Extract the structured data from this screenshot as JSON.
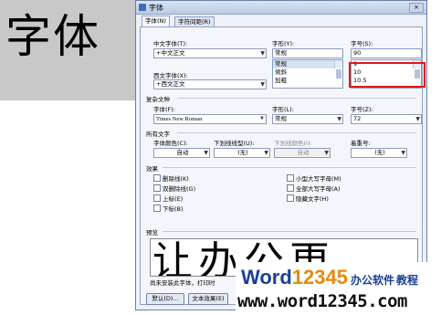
{
  "background_sample": {
    "text": "字体"
  },
  "window": {
    "title": "字体",
    "close_label": "×"
  },
  "tabs": [
    {
      "label": "字体(N)",
      "active": true
    },
    {
      "label": "字符间距(R)",
      "active": false
    }
  ],
  "chinese_font": {
    "label": "中文字体(T):",
    "value": "+中文正文"
  },
  "western_font": {
    "label": "西文字体(X):",
    "value": "+西文正文"
  },
  "style": {
    "label": "字形(Y):",
    "value": "常规",
    "options": [
      "常规",
      "倾斜",
      "加粗"
    ],
    "selected": "常规"
  },
  "size": {
    "label": "字号(S):",
    "value": "90",
    "options": [
      "9",
      "10",
      "10.5"
    ]
  },
  "complex_script": {
    "section_label": "复杂文种",
    "font_label": "字体(F):",
    "font_value": "Times New Roman",
    "style_label": "字形(L):",
    "style_value": "常规",
    "size_label": "字号(Z):",
    "size_value": "72"
  },
  "all_text": {
    "section_label": "所有文字",
    "color_label": "字体颜色(C):",
    "color_value": "自动",
    "underline_label": "下划线线型(U):",
    "underline_value": "(无)",
    "underline_color_label": "下划线颜色(I):",
    "underline_color_value": "自动",
    "emphasis_label": "着重号:",
    "emphasis_value": "(无)"
  },
  "effects": {
    "section_label": "效果",
    "left": [
      "删除线(K)",
      "双删除线(G)",
      "上标(E)",
      "下标(B)"
    ],
    "right": [
      "小型大写字母(M)",
      "全部大写字母(A)",
      "隐藏文字(H)"
    ]
  },
  "preview": {
    "section_label": "预览",
    "sample_text": "让办公更",
    "note": "尚未安装此字体，打印时"
  },
  "buttons": {
    "default": "默认(D)...",
    "text_effects": "文本效果(E)"
  },
  "watermark": {
    "word": "Word",
    "number": "12345",
    "cn1": "办公软件",
    "cn2": "教程",
    "url": "www.word12345.com"
  },
  "colors": {
    "highlight_border": "#e01818",
    "watermark_blue": "#1a3f99",
    "watermark_orange": "#e8890a"
  }
}
